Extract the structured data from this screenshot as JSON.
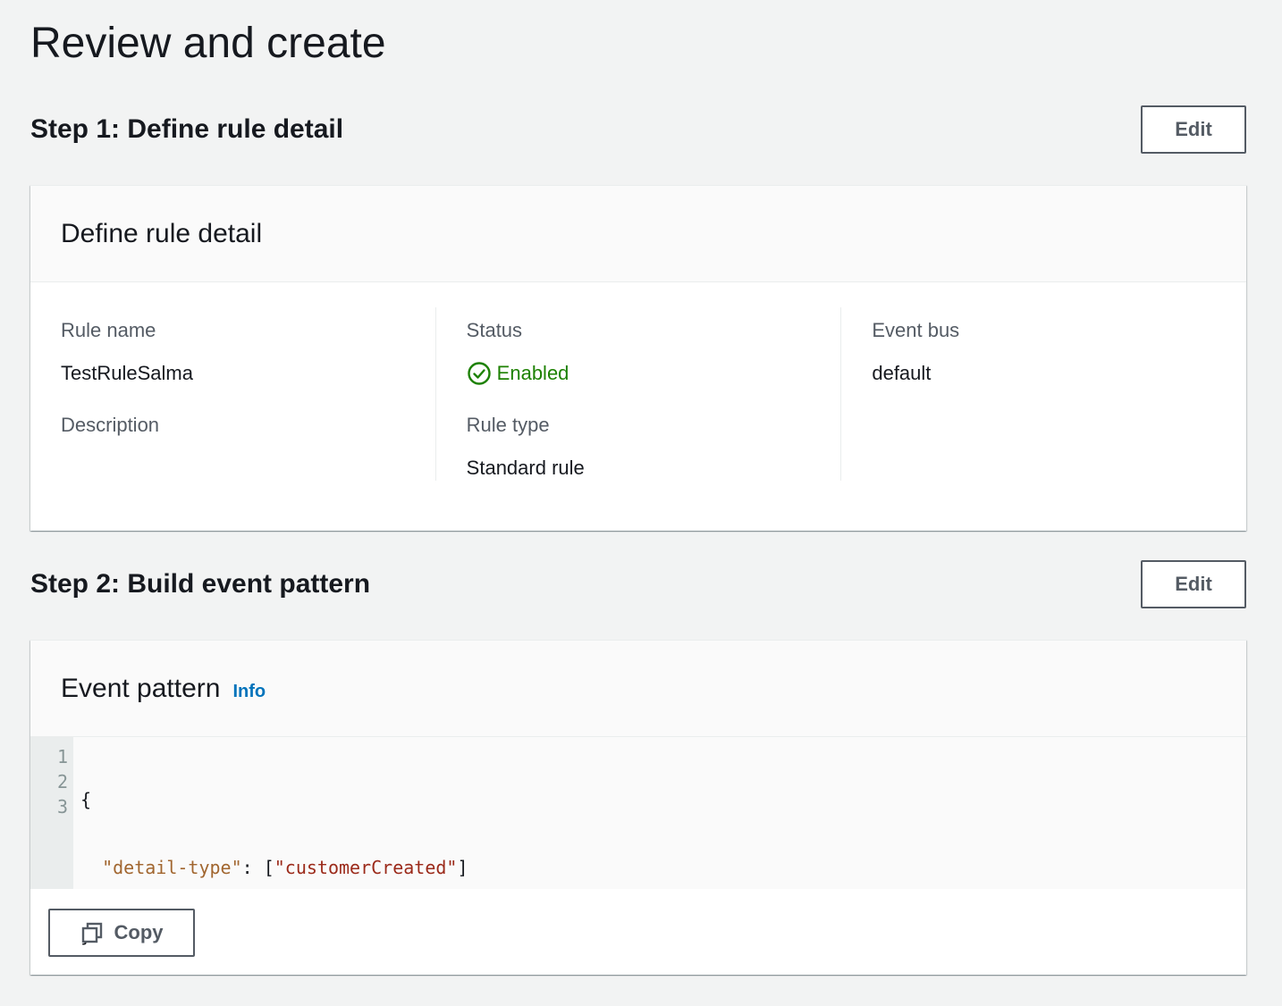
{
  "page": {
    "title": "Review and create"
  },
  "step1": {
    "title": "Step 1: Define rule detail",
    "edit_label": "Edit",
    "card": {
      "title": "Define rule detail",
      "rule_name_label": "Rule name",
      "rule_name_value": "TestRuleSalma",
      "description_label": "Description",
      "status_label": "Status",
      "status_value": "Enabled",
      "status_icon": "check-circle-icon",
      "rule_type_label": "Rule type",
      "rule_type_value": "Standard rule",
      "event_bus_label": "Event bus",
      "event_bus_value": "default"
    }
  },
  "step2": {
    "title": "Step 2: Build event pattern",
    "edit_label": "Edit",
    "card": {
      "title": "Event pattern",
      "info_label": "Info",
      "line_numbers": [
        "1",
        "2",
        "3"
      ],
      "code": {
        "line1": "{",
        "line2_indent": "  ",
        "line2_key": "\"detail-type\"",
        "line2_sep": ": [",
        "line2_value": "\"customerCreated\"",
        "line2_end": "]",
        "line3": "}"
      },
      "copy_label": "Copy",
      "copy_icon": "copy-icon"
    }
  },
  "colors": {
    "status_green": "#1d8102",
    "link_blue": "#0073bb",
    "json_key": "#a1662f",
    "json_string": "#9b2a1a"
  }
}
